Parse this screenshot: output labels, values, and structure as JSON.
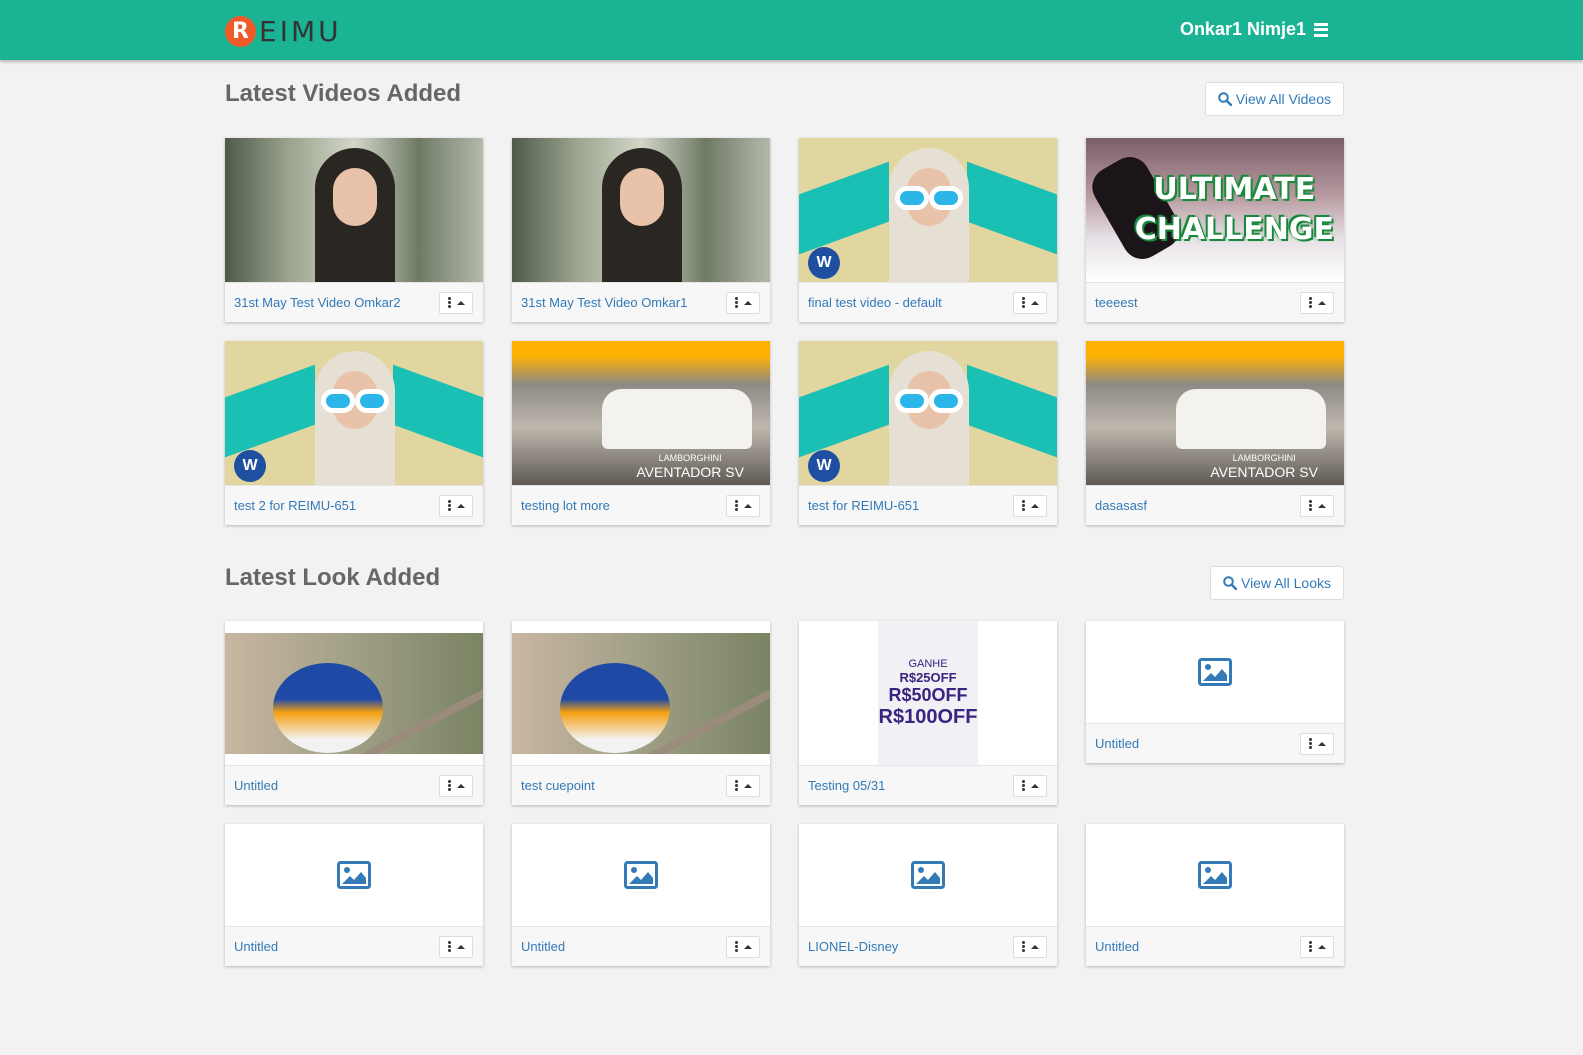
{
  "header": {
    "logo_letter": "R",
    "logo_text": "EIMU",
    "user_name": "Onkar1 Nimje1"
  },
  "videos_section": {
    "title": "Latest Videos Added",
    "view_all_label": "View All Videos",
    "items": [
      {
        "title": "31st May Test Video Omkar2"
      },
      {
        "title": "31st May Test Video Omkar1"
      },
      {
        "title": "final test video - default"
      },
      {
        "title": "teeeest",
        "thumb_text": [
          "ULTIMATE",
          "CHALLENGE"
        ]
      },
      {
        "title": "test 2 for REIMU-651"
      },
      {
        "title": "testing lot more",
        "thumb_text": [
          "LAMBORGHINI",
          "AVENTADOR SV"
        ]
      },
      {
        "title": "test for REIMU-651"
      },
      {
        "title": "dasasasf",
        "thumb_text": [
          "LAMBORGHINI",
          "AVENTADOR SV"
        ]
      }
    ]
  },
  "looks_section": {
    "title": "Latest Look Added",
    "view_all_label": "View All Looks",
    "items": [
      {
        "title": "Untitled"
      },
      {
        "title": "test cuepoint"
      },
      {
        "title": "Testing 05/31",
        "thumb_text": [
          "GANHE",
          "R$25OFF",
          "R$50OFF",
          "R$100OFF"
        ]
      },
      {
        "title": "Untitled"
      },
      {
        "title": "Untitled"
      },
      {
        "title": "Untitled"
      },
      {
        "title": "LIONEL-Disney"
      },
      {
        "title": "Untitled"
      }
    ]
  },
  "colors": {
    "topbar": "#1ab394",
    "link": "#337ab7",
    "logo_badge": "#f05a28"
  }
}
